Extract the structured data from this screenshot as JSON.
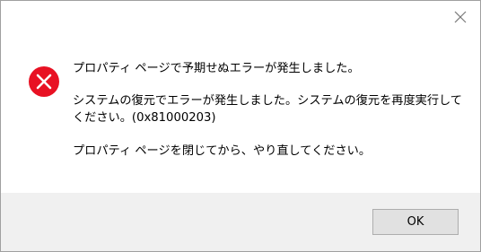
{
  "dialog": {
    "close_icon": "close-icon",
    "error_icon": "error-icon",
    "error_color": "#e81123",
    "message_title": "プロパティ ページで予期せぬエラーが発生しました。",
    "message_detail": "システムの復元でエラーが発生しました。システムの復元を再度実行してください。(0x81000203)",
    "message_action": "プロパティ ページを閉じてから、やり直してください。",
    "ok_label": "OK"
  }
}
